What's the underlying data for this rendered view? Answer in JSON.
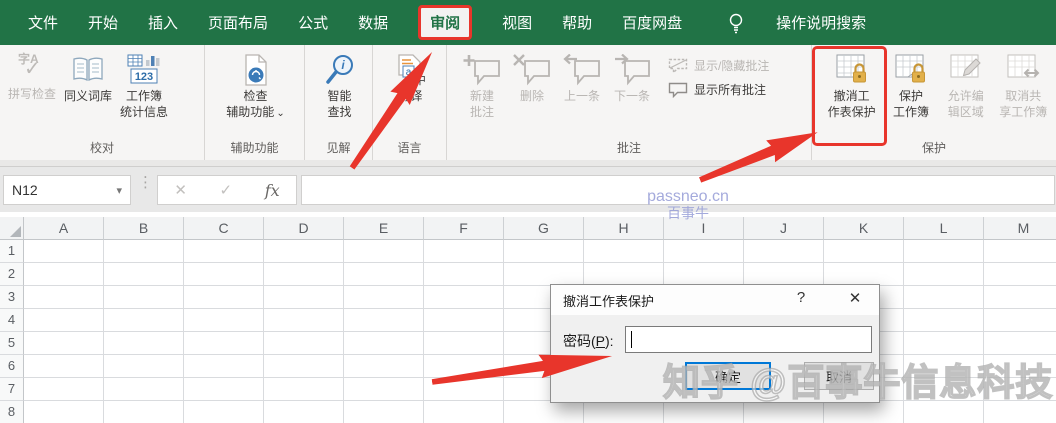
{
  "colors": {
    "excel_green": "#217346",
    "annotation_red": "#e8352b",
    "focus_blue": "#0078d7",
    "watermark_blue": "#959cd6"
  },
  "menubar": {
    "items": [
      "文件",
      "开始",
      "插入",
      "页面布局",
      "公式",
      "数据",
      "审阅",
      "视图",
      "帮助",
      "百度网盘"
    ],
    "active_item": "审阅",
    "search_label": "操作说明搜索"
  },
  "ribbon": {
    "proofing": {
      "label": "校对",
      "spell_icon_text": "字A",
      "spell": "拼写检查",
      "thesaurus": "同义词库",
      "stats_line1": "工作簿",
      "stats_line2": "统计信息",
      "stats_icon_text": "123"
    },
    "accessibility": {
      "label": "辅助功能",
      "check_line1": "检查",
      "check_line2": "辅助功能",
      "caret": "⌄"
    },
    "insights": {
      "label": "见解",
      "smart_line1": "智能",
      "smart_line2": "查找"
    },
    "language": {
      "label": "语言",
      "translate": "翻译"
    },
    "comments": {
      "label": "批注",
      "new_line1": "新建",
      "new_line2": "批注",
      "delete": "删除",
      "previous": "上一条",
      "next": "下一条",
      "show_hide": "显示/隐藏批注",
      "show_all": "显示所有批注"
    },
    "protection": {
      "label": "保护",
      "unprotect_line1": "撤消工",
      "unprotect_line2": "作表保护",
      "protect_wb_line1": "保护",
      "protect_wb_line2": "工作簿",
      "allow_edit_line1": "允许编",
      "allow_edit_line2": "辑区域",
      "unshare_line1": "取消共",
      "unshare_line2": "享工作簿"
    }
  },
  "formula_bar": {
    "name_box": "N12",
    "cancel_icon": "✕",
    "enter_icon": "✓",
    "fx_icon": "fx",
    "name_box_caret": "▾",
    "handle_dots": "⋮",
    "value": ""
  },
  "sheet": {
    "columns": [
      "A",
      "B",
      "C",
      "D",
      "E",
      "F",
      "G",
      "H",
      "I",
      "J",
      "K",
      "L",
      "M"
    ],
    "rows": [
      "1",
      "2",
      "3",
      "4",
      "5",
      "6",
      "7",
      "8"
    ]
  },
  "dialog": {
    "title": "撤消工作表保护",
    "help_icon": "?",
    "close_icon": "✕",
    "password_prefix": "密码(",
    "password_key": "P",
    "password_suffix": "):",
    "password_value": "",
    "ok_label": "确定",
    "cancel_label": "取消"
  },
  "watermarks": {
    "site_line1": "passneo.cn",
    "site_line2": "百事牛",
    "big": "知乎 @百事牛信息科技"
  }
}
